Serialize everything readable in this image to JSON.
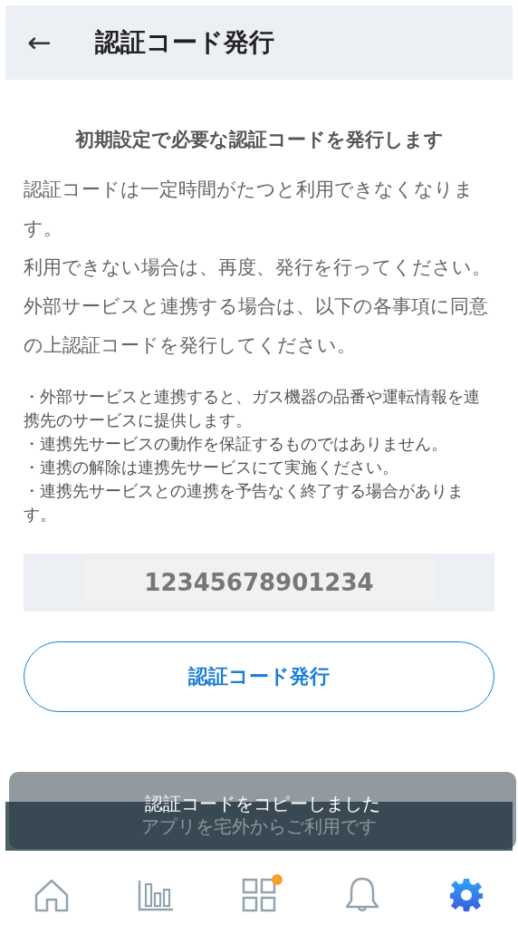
{
  "header": {
    "back": "←",
    "title": "認証コード発行"
  },
  "heading": "初期設定で必要な認証コードを発行します",
  "paragraphs": [
    "認証コードは一定時間がたつと利用できなくなります。",
    "利用できない場合は、再度、発行を行ってください。",
    "外部サービスと連携する場合は、以下の各事項に同意の上認証コードを発行してください。"
  ],
  "notes": [
    "・外部サービスと連携すると、ガス機器の品番や運転情報を連携先のサービスに提供します。",
    "・連携先サービスの動作を保証するものではありません。",
    "・連携の解除は連携先サービスにて実施ください。",
    "・連携先サービスとの連携を予告なく終了する場合があります。"
  ],
  "code": "12345678901234",
  "issue_button": "認証コード発行",
  "banner": "アプリを宅外からご利用です",
  "toast": "認証コードをコピーしました",
  "tabs": [
    {
      "kind": "home",
      "selected": false,
      "badge": false
    },
    {
      "kind": "chart",
      "selected": false,
      "badge": false
    },
    {
      "kind": "grid",
      "selected": false,
      "badge": true
    },
    {
      "kind": "bell",
      "selected": false,
      "badge": false
    },
    {
      "kind": "gear",
      "selected": true,
      "badge": false
    }
  ]
}
